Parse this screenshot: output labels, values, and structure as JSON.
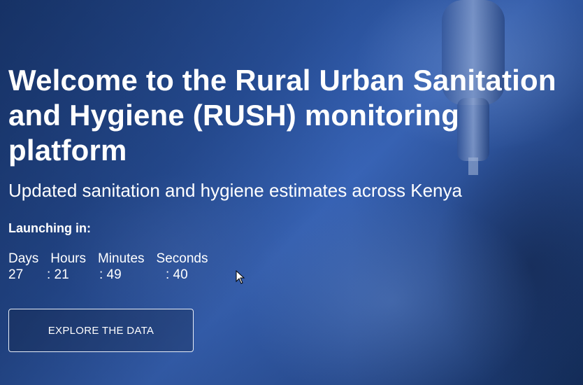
{
  "hero": {
    "title": "Welcome to the Rural Urban Sanitation and Hygiene (RUSH) monitoring platform",
    "subtitle": "Updated sanitation and hygiene estimates across Kenya"
  },
  "countdown": {
    "label": "Launching in:",
    "days_label": "Days",
    "hours_label": "Hours",
    "minutes_label": "Minutes",
    "seconds_label": "Seconds",
    "days_value": "27",
    "hours_value": ": 21",
    "minutes_value": ": 49",
    "seconds_value": ": 40"
  },
  "cta": {
    "label": "EXPLORE THE DATA"
  },
  "icons": {
    "cursor": "mouse-pointer-icon"
  },
  "colors": {
    "accent": "#2b55a3",
    "text": "#ffffff"
  }
}
